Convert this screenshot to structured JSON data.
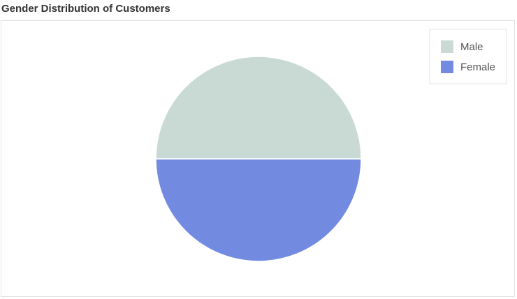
{
  "chart_data": {
    "type": "pie",
    "title": "Gender Distribution of Customers",
    "categories": [
      "Male",
      "Female"
    ],
    "values": [
      50,
      50
    ],
    "colors": [
      "#c8dad3",
      "#728be0"
    ],
    "legend": {
      "placement": "top-right",
      "entries": [
        "Male",
        "Female"
      ]
    }
  }
}
